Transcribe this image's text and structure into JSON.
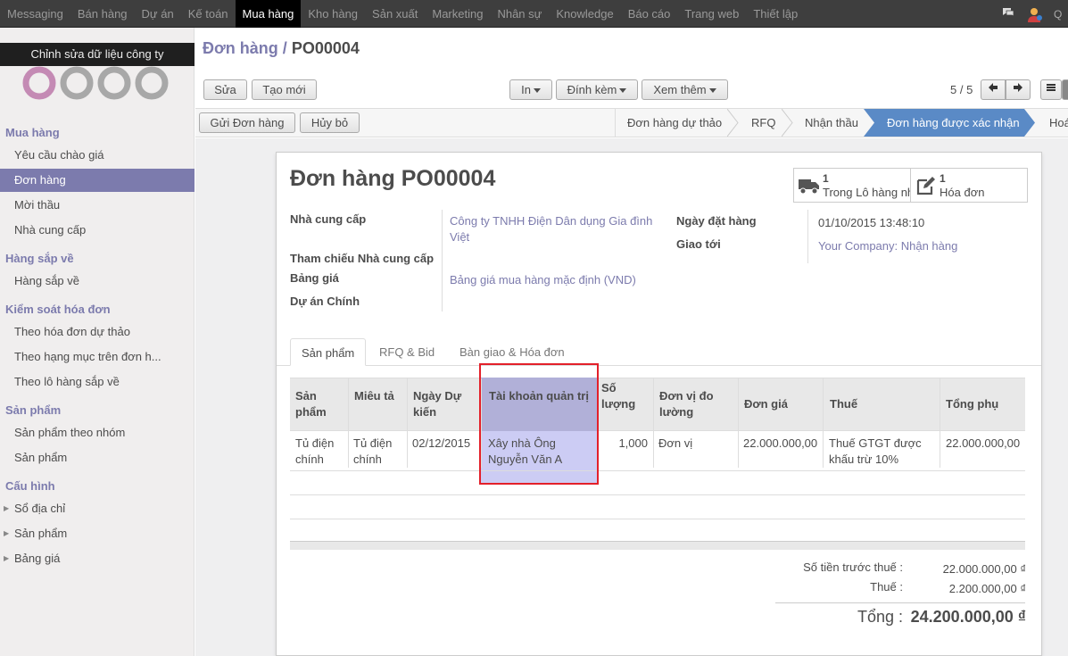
{
  "topnav": {
    "items": [
      "Messaging",
      "Bán hàng",
      "Dự án",
      "Kế toán",
      "Mua hàng",
      "Kho hàng",
      "Sản xuất",
      "Marketing",
      "Nhân sự",
      "Knowledge",
      "Báo cáo",
      "Trang web",
      "Thiết lập"
    ],
    "active": "Mua hàng",
    "user_initial": "Q"
  },
  "sidebar": {
    "company_edit": "Chỉnh sửa dữ liệu công ty",
    "logo_text": "odoo",
    "sections": [
      {
        "title": "Mua hàng",
        "items": [
          "Yêu cầu chào giá",
          "Đơn hàng",
          "Mời thầu",
          "Nhà cung cấp"
        ]
      },
      {
        "title": "Hàng sắp về",
        "items": [
          "Hàng sắp về"
        ]
      },
      {
        "title": "Kiểm soát hóa đơn",
        "items": [
          "Theo hóa đơn dự thảo",
          "Theo hạng mục trên đơn h...",
          "Theo lô hàng sắp về"
        ]
      },
      {
        "title": "Sản phẩm",
        "items": [
          "Sản phẩm theo nhóm",
          "Sản phẩm"
        ]
      },
      {
        "title": "Cấu hình",
        "items": [
          "Sổ địa chỉ",
          "Sản phẩm",
          "Bảng giá"
        ]
      }
    ],
    "active_item": "Đơn hàng"
  },
  "header": {
    "breadcrumb_parent": "Đơn hàng",
    "breadcrumb_sep": " / ",
    "breadcrumb_current": "PO00004",
    "edit_label": "Sửa",
    "create_label": "Tạo mới",
    "print_label": "In",
    "attach_label": "Đính kèm",
    "more_label": "Xem thêm",
    "pager": "5 / 5"
  },
  "statusbar": {
    "send_label": "Gửi Đơn hàng",
    "cancel_label": "Hủy bỏ",
    "stages": [
      "Đơn hàng dự thảo",
      "RFQ",
      "Nhận thầu",
      "Đơn hàng được xác nhận",
      "Hoá"
    ],
    "active_stage": "Đơn hàng được xác nhận"
  },
  "form": {
    "title": "Đơn hàng PO00004",
    "smart_buttons": [
      {
        "count": "1",
        "label": "Trong Lô hàng nh",
        "icon": "truck-icon"
      },
      {
        "count": "1",
        "label": "Hóa đơn",
        "icon": "pencil-square-icon"
      }
    ],
    "fields": {
      "supplier_label": "Nhà cung cấp",
      "supplier_value_line1": "Công ty TNHH Điện Dân dụng Gia đình",
      "supplier_value_line2": "Việt",
      "supplier_ref_label": "Tham chiếu Nhà cung cấp",
      "pricelist_label": "Bảng giá",
      "pricelist_value": "Bảng giá mua hàng mặc định (VND)",
      "project_label": "Dự án Chính",
      "order_date_label": "Ngày đặt hàng",
      "order_date_value": "01/10/2015 13:48:10",
      "deliver_to_label": "Giao tới",
      "deliver_to_value": "Your Company: Nhận hàng"
    },
    "tabs": [
      "Sản phẩm",
      "RFQ & Bid",
      "Bàn giao & Hóa đơn"
    ],
    "table": {
      "headers": [
        {
          "line1": "Sản",
          "line2": "phẩm"
        },
        {
          "line1": "Miêu tả",
          "line2": ""
        },
        {
          "line1": "Ngày Dự",
          "line2": "kiến"
        },
        {
          "line1": "Tài khoản quản trị",
          "line2": ""
        },
        {
          "line1": "Số",
          "line2": "lượng"
        },
        {
          "line1": "Đơn vị đo",
          "line2": "lường"
        },
        {
          "line1": "Đơn giá",
          "line2": ""
        },
        {
          "line1": "Thuế",
          "line2": ""
        },
        {
          "line1": "Tổng phụ",
          "line2": ""
        }
      ],
      "row": {
        "product_l1": "Tủ điện",
        "product_l2": "chính",
        "desc_l1": "Tủ điện",
        "desc_l2": "chính",
        "date": "02/12/2015",
        "account_l1": "Xây nhà Ông",
        "account_l2": "Nguyễn Văn A",
        "qty": "1,000",
        "uom": "Đơn vị",
        "price": "22.000.000,00",
        "tax_l1": "Thuế GTGT được",
        "tax_l2": "khấu trừ 10%",
        "subtotal": "22.000.000,00"
      }
    },
    "totals": {
      "untaxed_label": "Số tiền trước thuế :",
      "untaxed_value": "22.000.000,00 ₫",
      "tax_label": "Thuế :",
      "tax_value": "2.200.000,00 ₫",
      "total_label": "Tổng :",
      "total_value": "24.200.000,00 ₫"
    }
  },
  "colors": {
    "accent": "#7c7bad",
    "active_stage": "#5a8ac6",
    "highlight_border": "#e3202a"
  }
}
